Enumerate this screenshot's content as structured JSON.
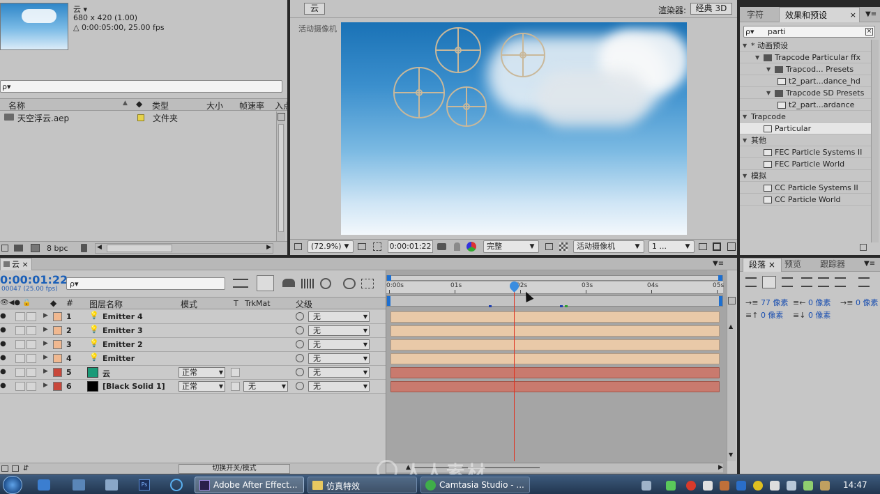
{
  "project_panel": {
    "comp_name": "云 ▾",
    "comp_size": "680 x 420 (1.00)",
    "comp_duration": "△ 0:00:05:00, 25.00 fps",
    "search_placeholder": "ρ▾",
    "columns": [
      "名称",
      "类型",
      "大小",
      "帧速率",
      "入点"
    ],
    "items": [
      {
        "name": "天空浮云.aep",
        "type": "文件夹"
      }
    ],
    "bpc": "8 bpc"
  },
  "comp_viewer": {
    "tab": "云",
    "renderer_label": "渲染器:",
    "renderer_value": "经典 3D",
    "camera_label": "活动摄像机",
    "zoom": "(72.9%)",
    "timecode": "0:00:01:22",
    "resolution": "完整",
    "view": "活动摄像机",
    "views_count": "1 ..."
  },
  "effects_panel": {
    "tabs": [
      "字符",
      "效果和预设"
    ],
    "search_value": "parti",
    "tree": [
      {
        "label": "* 动画预设",
        "level": 0,
        "kind": "toggle"
      },
      {
        "label": "Trapcode Particular ffx",
        "level": 1,
        "kind": "folder"
      },
      {
        "label": "Trapcod... Presets",
        "level": 2,
        "kind": "folder"
      },
      {
        "label": "t2_part...dance_hd",
        "level": 3,
        "kind": "file"
      },
      {
        "label": "Trapcode SD Presets",
        "level": 2,
        "kind": "folder"
      },
      {
        "label": "t2_part...ardance",
        "level": 3,
        "kind": "file"
      },
      {
        "label": "Trapcode",
        "level": 0,
        "kind": "toggle"
      },
      {
        "label": "Particular",
        "level": 1,
        "kind": "effect",
        "selected": true
      },
      {
        "label": "其他",
        "level": 0,
        "kind": "toggle"
      },
      {
        "label": "FEC Particle Systems II",
        "level": 1,
        "kind": "effect"
      },
      {
        "label": "FEC Particle World",
        "level": 1,
        "kind": "effect"
      },
      {
        "label": "模拟",
        "level": 0,
        "kind": "toggle"
      },
      {
        "label": "CC Particle Systems II",
        "level": 1,
        "kind": "effect"
      },
      {
        "label": "CC Particle World",
        "level": 1,
        "kind": "effect"
      }
    ]
  },
  "paragraph_panel": {
    "tabs": [
      "段落",
      "预览",
      "跟踪器"
    ],
    "indent_left": "77 像素",
    "indent_right": "0 像素",
    "indent_first": "0 像素",
    "space_before": "0 像素",
    "space_after": "0 像素"
  },
  "timeline": {
    "tab": "云",
    "timecode": "0:00:01:22",
    "frames": "00047 (25.00 fps)",
    "search_placeholder": "ρ▾",
    "columns": {
      "name": "图层名称",
      "mode": "模式",
      "t": "T",
      "trkmat": "TrkMat",
      "parent": "父级",
      "num": "#"
    },
    "ruler": [
      "0:00s",
      "01s",
      "02s",
      "03s",
      "04s",
      "05s"
    ],
    "layers": [
      {
        "num": "1",
        "name": "Emitter 4",
        "label_color": "#f0b890",
        "kind": "light",
        "mode": "",
        "trkmat": "",
        "parent": "无"
      },
      {
        "num": "2",
        "name": "Emitter 3",
        "label_color": "#f0b890",
        "kind": "light",
        "mode": "",
        "trkmat": "",
        "parent": "无"
      },
      {
        "num": "3",
        "name": "Emitter 2",
        "label_color": "#f0b890",
        "kind": "light",
        "mode": "",
        "trkmat": "",
        "parent": "无"
      },
      {
        "num": "4",
        "name": "Emitter",
        "label_color": "#f0b890",
        "kind": "light",
        "mode": "",
        "trkmat": "",
        "parent": "无"
      },
      {
        "num": "5",
        "name": "云",
        "label_color": "#c8473a",
        "kind": "solid",
        "swatch": "#1a9a78",
        "mode": "正常",
        "trkmat": "",
        "parent": "无"
      },
      {
        "num": "6",
        "name": "[Black Solid 1]",
        "label_color": "#c8473a",
        "kind": "solid",
        "swatch": "#000000",
        "mode": "正常",
        "trkmat": "无",
        "parent": "无"
      }
    ],
    "footer_button": "切换开关/模式"
  },
  "taskbar": {
    "tasks": [
      "Adobe After Effect...",
      "仿真特效",
      "Camtasia Studio - ..."
    ],
    "clock": "14:47"
  },
  "watermark": "人人素材"
}
